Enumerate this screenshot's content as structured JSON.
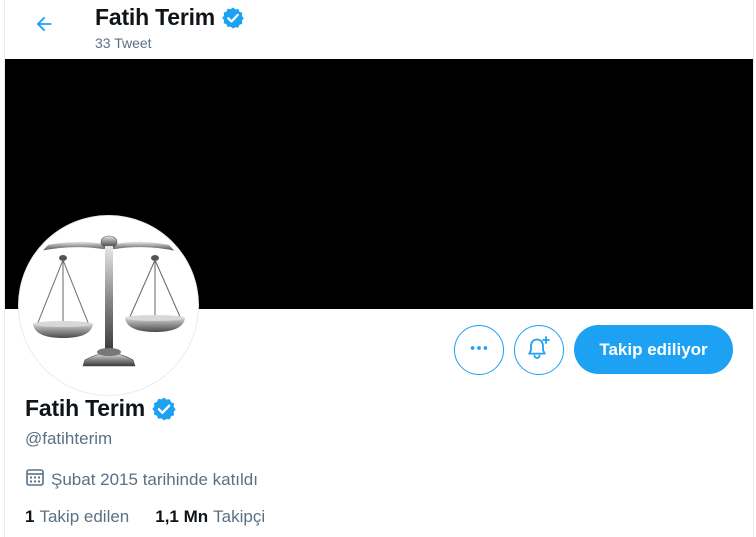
{
  "header": {
    "title": "Fatih Terim",
    "tweet_count": "33 Tweet"
  },
  "profile": {
    "name": "Fatih Terim",
    "handle": "@fatihterim",
    "joined": "Şubat 2015 tarihinde katıldı",
    "stats": {
      "following_count": "1",
      "following_label": "Takip edilen",
      "followers_count": "1,1 Mn",
      "followers_label": "Takipçi"
    }
  },
  "actions": {
    "follow_label": "Takip ediliyor",
    "more_icon": "more-horizontal-icon",
    "notify_icon": "bell-plus-icon"
  },
  "colors": {
    "accent": "#1da1f2",
    "banner": "#000000",
    "secondary_text": "#5b7083"
  }
}
